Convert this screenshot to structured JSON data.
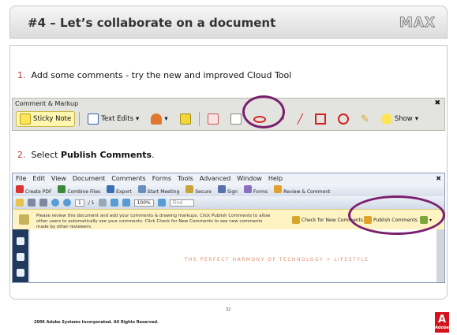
{
  "slide": {
    "title": "#4 – Let’s collaborate on a document",
    "brand": "MAX",
    "footer": "2006 Adobe Systems Incorporated.  All Rights Reserved.",
    "page_number": "32",
    "adobe_logo_text": "Adobe"
  },
  "steps": [
    {
      "num": "1.",
      "text": "Add  some comments  - try the new and improved Cloud Tool"
    },
    {
      "num": "2.",
      "text_prefix": "Select ",
      "text_bold": "Publish Comments",
      "text_suffix": "."
    }
  ],
  "comment_toolbar": {
    "title": "Comment & Markup",
    "close": "✖",
    "sticky_note": "Sticky Note",
    "text_edits": "Text Edits",
    "show": "Show",
    "colors": {
      "sticky_bg": "#fff7b0",
      "highlight_circle": "#7b1f6f",
      "shape_red": "#d22222"
    }
  },
  "acrobat": {
    "menu": [
      "File",
      "Edit",
      "View",
      "Document",
      "Comments",
      "Forms",
      "Tools",
      "Advanced",
      "Window",
      "Help"
    ],
    "menu_close": "✖",
    "toolbar1": [
      "Create PDF",
      "Combine Files",
      "Export",
      "Start Meeting",
      "Secure",
      "Sign",
      "Forms",
      "Review & Comment"
    ],
    "page_field": "1",
    "page_total": "/ 1",
    "zoom": "100%",
    "find_placeholder": "Find",
    "notice": "Please review this document and add your comments & drawing markups. Click Publish Comments to allow other users to automatically see your comments. Click Check for New Comments to see new comments made by other reviewers.",
    "check_new": "Check for New Comments",
    "publish": "Publish Comments",
    "page_text": "THE PERFECT HARMONY OF TECHNOLOGY + LIFESTYLE"
  }
}
